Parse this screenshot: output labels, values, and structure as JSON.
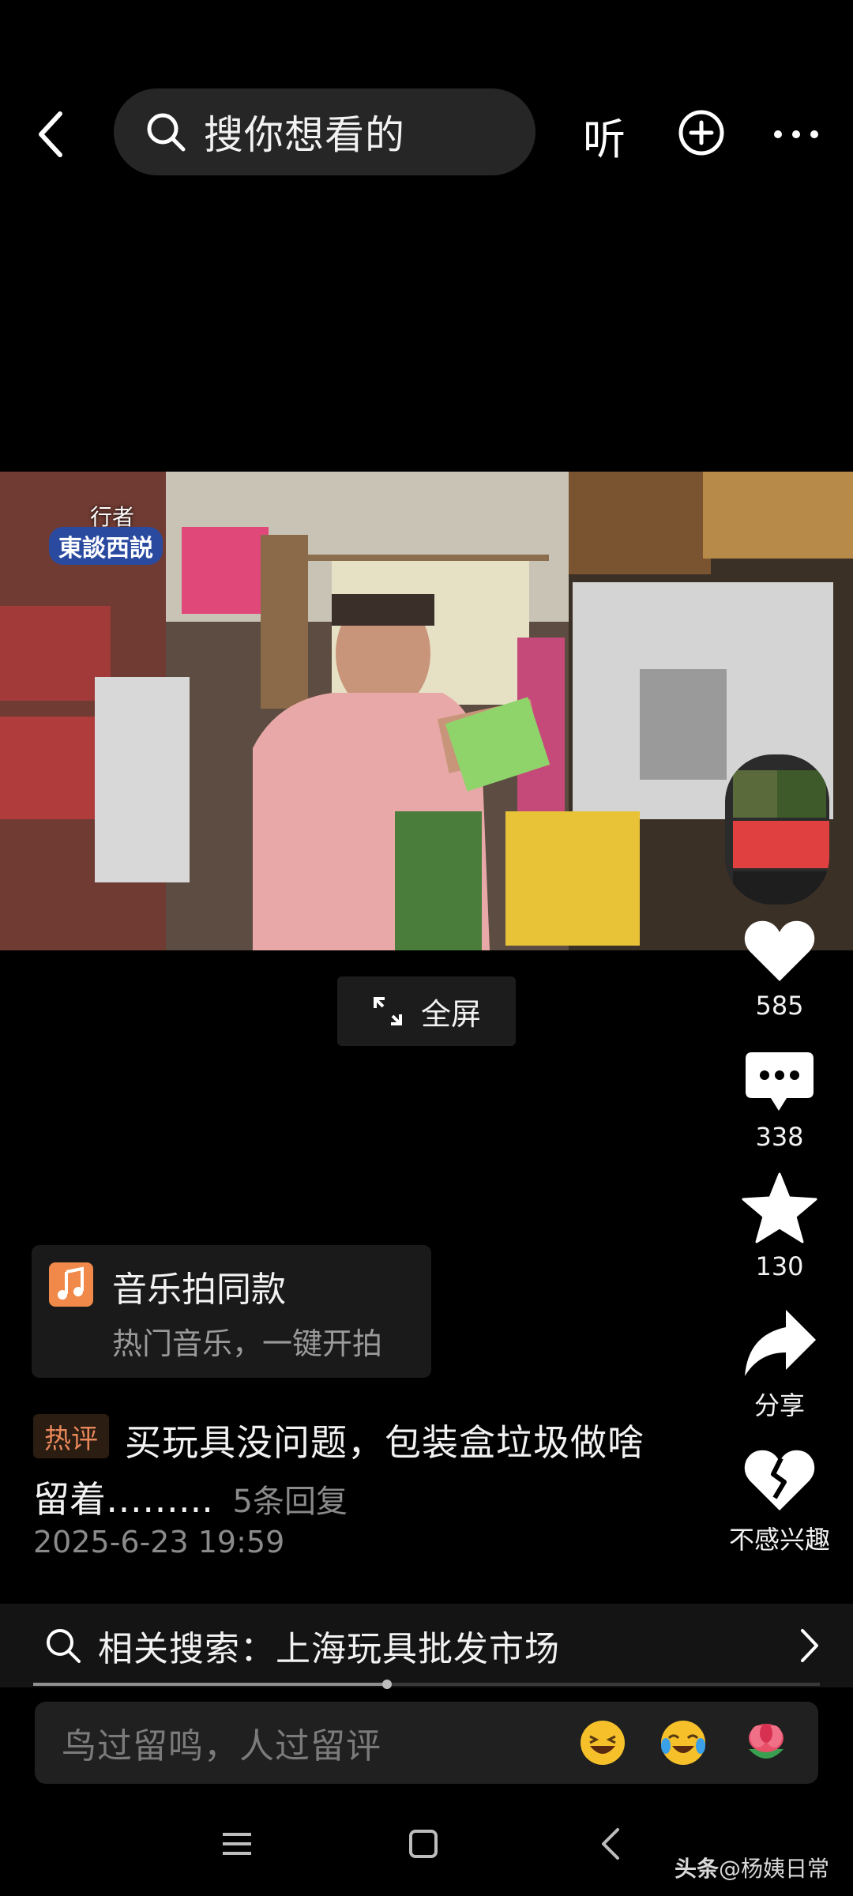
{
  "top_bar": {
    "search_placeholder": "搜你想看的",
    "listen_label": "听"
  },
  "video": {
    "overlay_logo_top": "行者",
    "overlay_logo_main": "東談西説",
    "fullscreen_label": "全屏"
  },
  "rail": {
    "like_count": "585",
    "comment_count": "338",
    "favorite_count": "130",
    "share_label": "分享",
    "not_interested_label": "不感兴趣"
  },
  "music": {
    "title": "音乐拍同款",
    "subtitle": "热门音乐，一键开拍"
  },
  "comment": {
    "badge": "热评",
    "line1": "买玩具没问题，包装盒垃圾做啥",
    "line2": "留着……...",
    "replies": "5条回复",
    "time": "2025-6-23 19:59"
  },
  "related_search": {
    "text": "相关搜索：上海玩具批发市场"
  },
  "playback": {
    "progress": 0.45
  },
  "comment_input": {
    "placeholder": "鸟过留鸣，人过留评"
  },
  "watermark": {
    "brand": "头条",
    "handle": "@杨姨日常"
  },
  "colors": {
    "background": "#000000",
    "hot_badge": "#e8875a",
    "music_icon": "#f0894a"
  }
}
